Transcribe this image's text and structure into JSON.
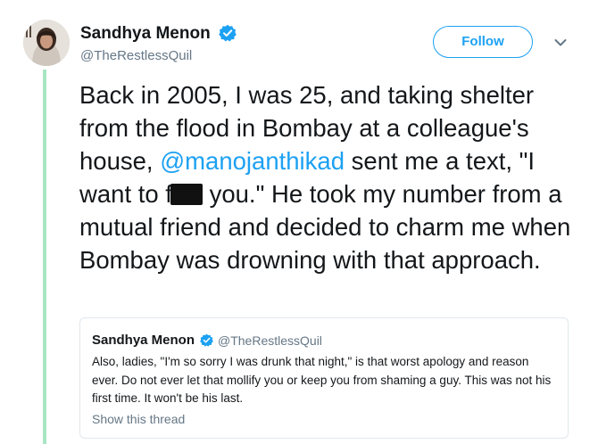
{
  "author": {
    "display_name": "Sandhya Menon",
    "handle": "@TheRestlessQuil",
    "verified": true
  },
  "actions": {
    "follow_label": "Follow",
    "menu_icon": "chevron-down-icon"
  },
  "tweet": {
    "part1": "Back in 2005, I was 25, and taking shelter from the flood in Bombay at a colleague's house, ",
    "mention": "@manojanthikad",
    "part2": " sent me a text, \"I want to f",
    "part3": " you.\" He took my number from a mutual friend and decided to charm me when Bombay was drowning with that approach."
  },
  "quote": {
    "display_name": "Sandhya Menon",
    "handle": "@TheRestlessQuil",
    "text": "Also, ladies, \"I'm so sorry I was drunk that night,\" is that worst apology and reason ever. Do not ever let that mollify you or keep you from shaming a guy. This was not his first time. It won't be his last.",
    "show_thread_label": "Show this thread"
  },
  "colors": {
    "accent": "#1da1f2",
    "thread_line": "#a8e6c4",
    "secondary_text": "#657786",
    "primary_text": "#14171a"
  }
}
